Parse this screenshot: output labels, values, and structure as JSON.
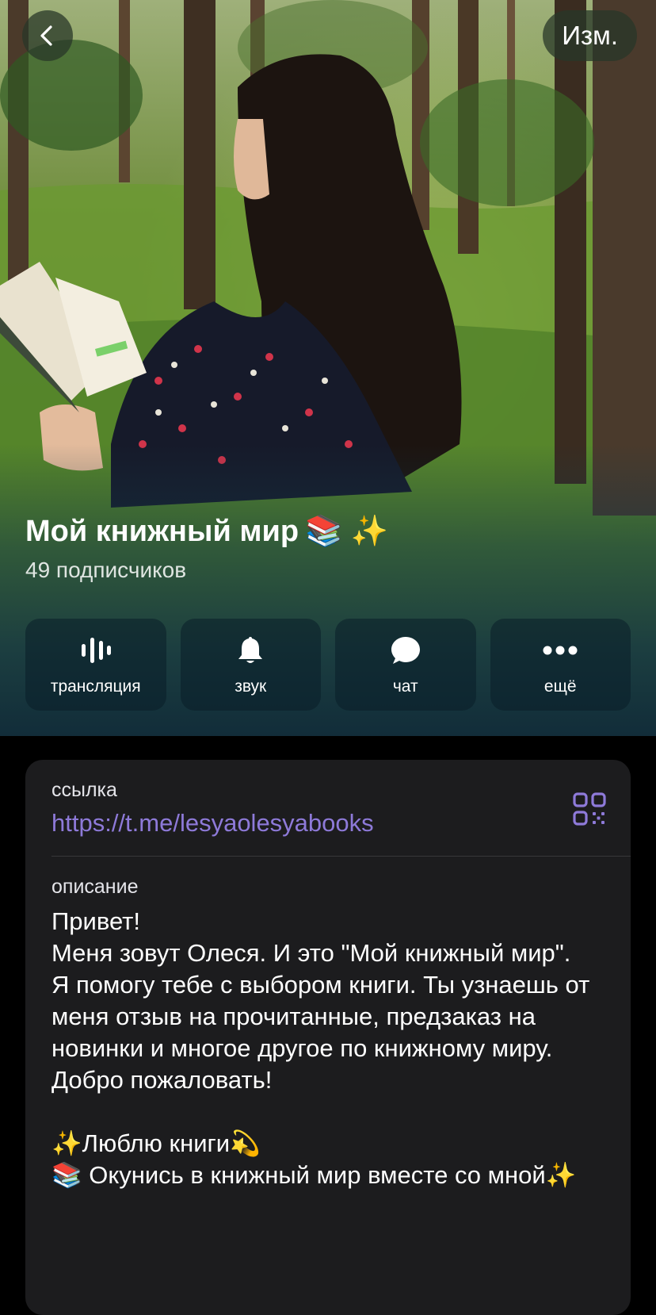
{
  "header": {
    "back_icon": "chevron-left-icon",
    "edit_label": "Изм."
  },
  "channel": {
    "title": "Мой книжный мир",
    "title_emoji": "📚 ✨",
    "subscribers": "49 подписчиков"
  },
  "actions": [
    {
      "label": "трансляция",
      "icon": "live-stream-icon"
    },
    {
      "label": "звук",
      "icon": "bell-icon"
    },
    {
      "label": "чат",
      "icon": "chat-bubble-icon"
    },
    {
      "label": "ещё",
      "icon": "more-dots-icon"
    }
  ],
  "info": {
    "link_label": "ссылка",
    "link_value": "https://t.me/lesyaolesyabooks",
    "qr_icon": "qr-code-icon",
    "description_label": "описание",
    "description_text": "Привет!\nМеня зовут Олеся. И это \"Мой книжный мир\".\nЯ помогу тебе с выбором книги. Ты узнаешь от меня отзыв на прочитанные, предзаказ на новинки и многое другое по книжному миру.\nДобро пожаловать!\n\n✨Люблю книги💫\n📚 Окунись в книжный мир вместе со мной✨"
  },
  "colors": {
    "accent_link": "#8e7ad9",
    "card_bg": "#1c1c1e",
    "page_bg": "#000000"
  }
}
